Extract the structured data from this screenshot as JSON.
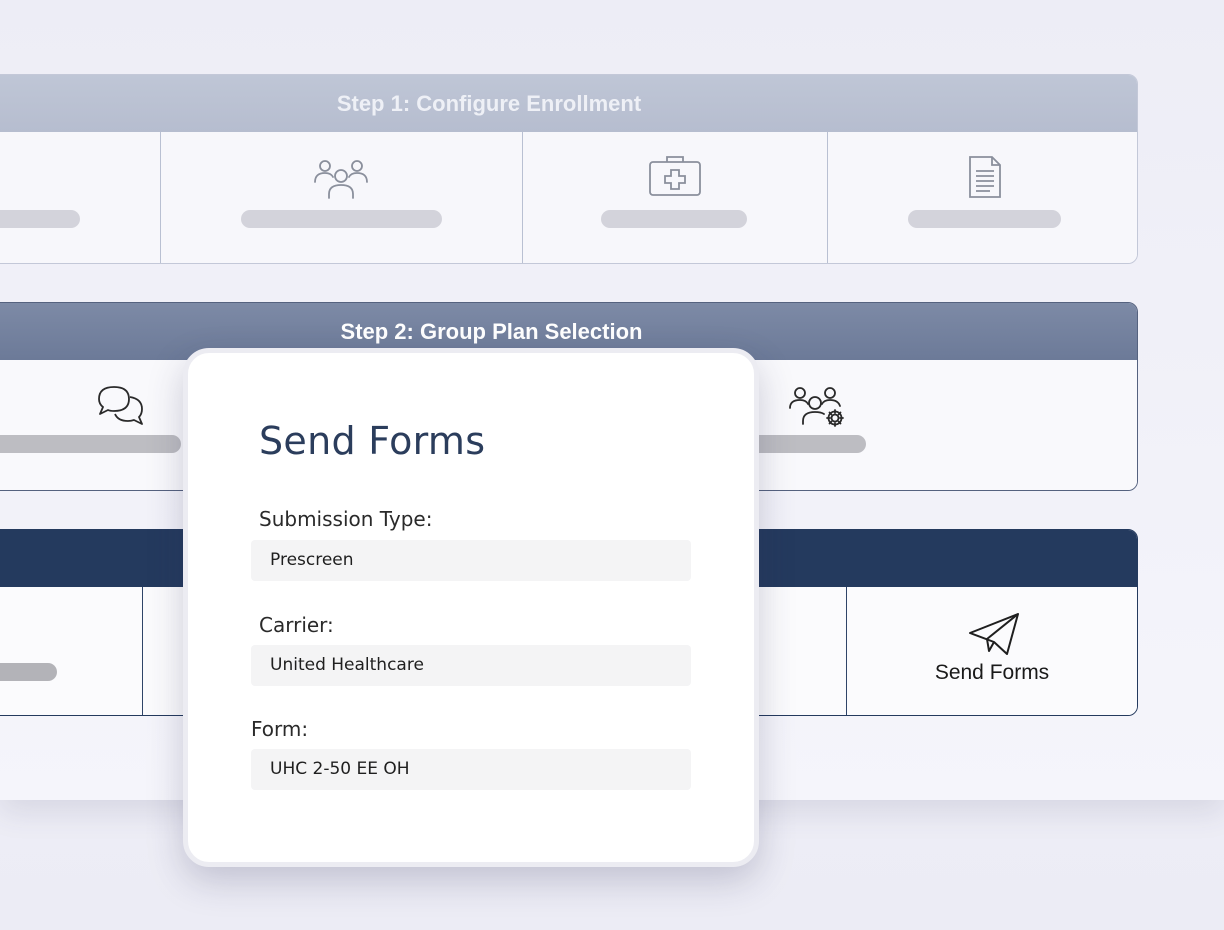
{
  "steps": {
    "step1": {
      "title": "Step 1: Configure Enrollment",
      "icons": [
        "users-group-icon",
        "medical-kit-icon",
        "document-icon"
      ]
    },
    "step2": {
      "title": "Step 2: Group Plan Selection",
      "icons": [
        "chat-bubbles-icon",
        "users-settings-icon"
      ]
    },
    "step3": {
      "title": "",
      "send_label": "Send Forms",
      "icons": [
        "paper-plane-icon"
      ]
    }
  },
  "modal": {
    "title": "Send Forms",
    "submission_type_label": "Submission Type:",
    "submission_type_value": "Prescreen",
    "carrier_label": "Carrier:",
    "carrier_value": "United Healthcare",
    "form_label": "Form:",
    "form_value": "UHC 2-50 EE OH"
  },
  "colors": {
    "step1_header": "#bfc6d6",
    "step2_header": "#76839f",
    "step3_header": "#243a5e",
    "modal_title": "#2b3d5c"
  }
}
